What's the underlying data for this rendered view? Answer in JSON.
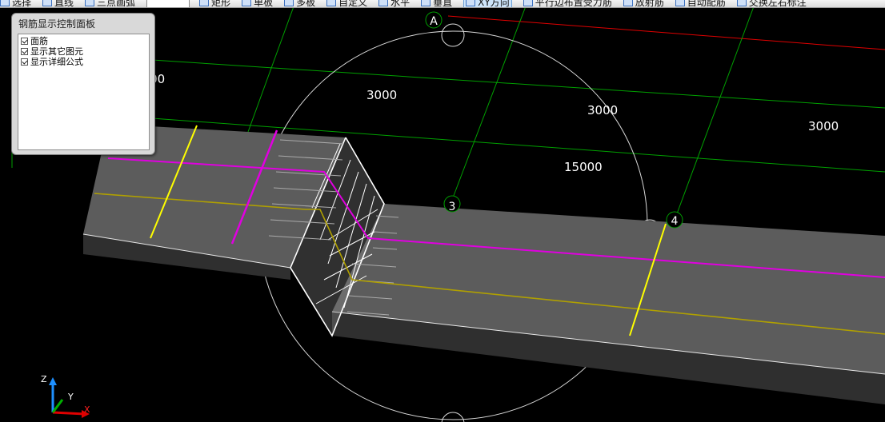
{
  "toolbar": {
    "items": [
      {
        "label": "选择",
        "icon": "select-arrow-icon",
        "active": false
      },
      {
        "label": "直线",
        "icon": "line-icon",
        "active": false
      },
      {
        "label": "三点画弧",
        "icon": "arc-icon",
        "active": false
      },
      {
        "label": "矩形",
        "icon": "rectangle-icon",
        "active": false
      },
      {
        "label": "单板",
        "icon": "single-slab-icon",
        "active": false
      },
      {
        "label": "多板",
        "icon": "multi-slab-icon",
        "active": false
      },
      {
        "label": "自定义",
        "icon": "custom-icon",
        "active": false
      },
      {
        "label": "水平",
        "icon": "horizontal-icon",
        "active": false
      },
      {
        "label": "垂直",
        "icon": "vertical-icon",
        "active": false
      },
      {
        "label": "XY方向",
        "icon": "xy-direction-icon",
        "active": true
      },
      {
        "label": "平行边布置受力筋",
        "icon": "parallel-rebar-icon",
        "active": false
      },
      {
        "label": "放射筋",
        "icon": "radial-rebar-icon",
        "active": false
      },
      {
        "label": "自动配筋",
        "icon": "auto-rebar-icon",
        "active": false
      },
      {
        "label": "交换左右标注",
        "icon": "swap-label-icon",
        "active": false
      }
    ]
  },
  "panel": {
    "title": "钢筋显示控制面板",
    "options": [
      {
        "label": "面筋",
        "checked": true
      },
      {
        "label": "显示其它图元",
        "checked": true
      },
      {
        "label": "显示详细公式",
        "checked": true
      }
    ]
  },
  "viewport": {
    "axis_labels": [
      "A",
      "3",
      "4"
    ],
    "dimensions": [
      "3000",
      "3000",
      "3000",
      "3000",
      "15000"
    ],
    "triad": {
      "z": "Z",
      "y": "Y",
      "x": "X"
    },
    "colors": {
      "background": "#000000",
      "grid_green": "#00a000",
      "grid_red": "#e00000",
      "rebar_magenta": "#e000e0",
      "rebar_yellow": "#ffff00",
      "beam_gray": "#5a5a5a"
    }
  }
}
